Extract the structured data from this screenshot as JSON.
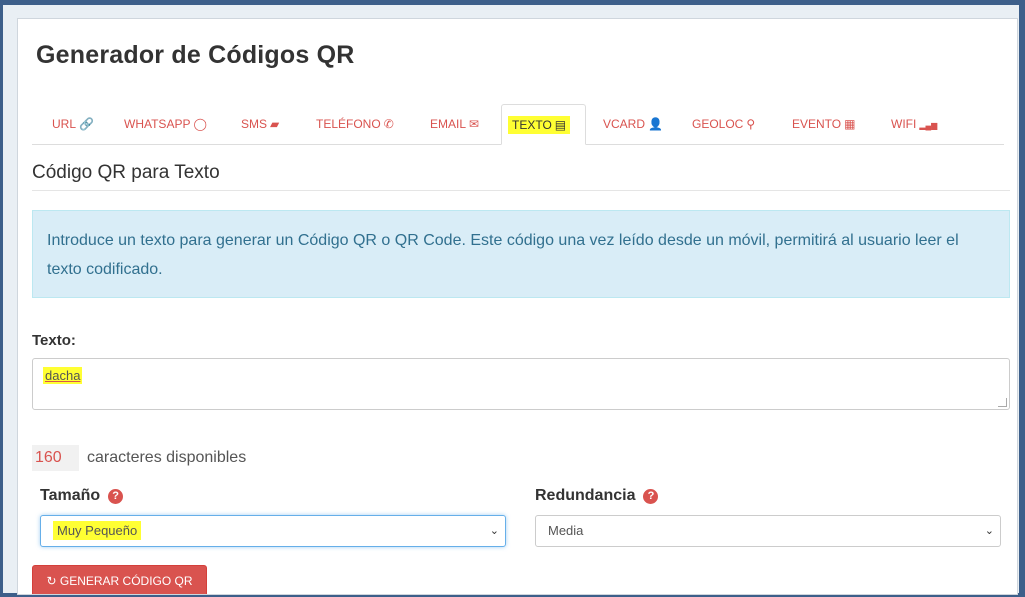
{
  "page": {
    "title": "Generador de Códigos QR",
    "subheading": "Código QR para Texto",
    "info": "Introduce un texto para generar un Código QR o QR Code. Este código una vez leído desde un móvil, permitirá al usuario leer el texto codificado."
  },
  "tabs": [
    {
      "label": "URL",
      "icon": "🔗"
    },
    {
      "label": "WHATSAPP",
      "icon": "◯"
    },
    {
      "label": "SMS",
      "icon": "▰"
    },
    {
      "label": "TELÉFONO",
      "icon": "✆"
    },
    {
      "label": "EMAIL",
      "icon": "✉"
    },
    {
      "label": "TEXTO",
      "icon": "▤"
    },
    {
      "label": "VCARD",
      "icon": "👤"
    },
    {
      "label": "GEOLOC",
      "icon": "⚲"
    },
    {
      "label": "EVENTO",
      "icon": "▦"
    },
    {
      "label": "WIFI",
      "icon": "▂▄▆"
    }
  ],
  "form": {
    "text_label": "Texto:",
    "text_value": "dacha",
    "chars_available": "160",
    "chars_text": "caracteres disponibles",
    "size_label": "Tamaño",
    "size_value": "Muy Pequeño",
    "redundancy_label": "Redundancia",
    "redundancy_value": "Media",
    "help_glyph": "?",
    "chevron_glyph": "⌄",
    "generate_button": "GENERAR CÓDIGO QR",
    "generate_icon": "↻"
  },
  "colors": {
    "accent": "#d9534f",
    "info_bg": "#d9edf7",
    "highlight": "#ffff33"
  }
}
